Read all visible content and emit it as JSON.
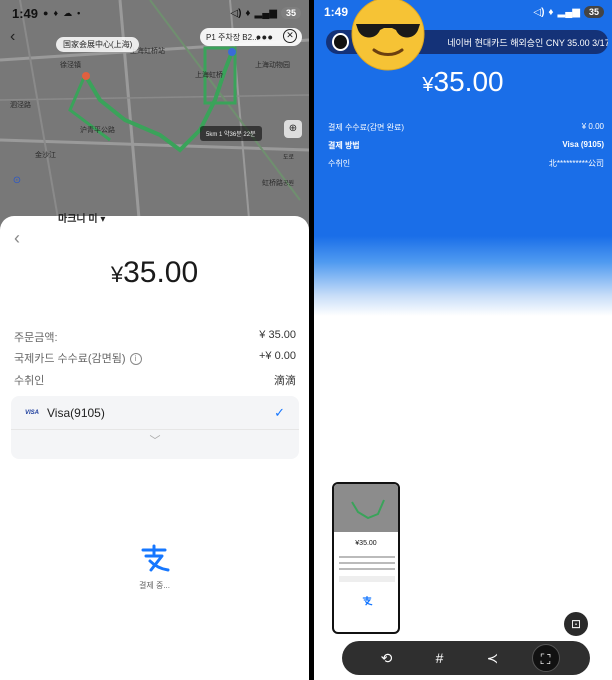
{
  "left": {
    "status": {
      "time": "1:49",
      "battery": "35"
    },
    "map": {
      "badge": "国家会展中心(上海)",
      "pill": "P1 주차장 B2...",
      "labels": [
        "徐泾镇",
        "上海虹桥站",
        "上海虹桥",
        "上海动物园",
        "沪青平公路",
        "泗泾路",
        "金沙江",
        "虹桥路"
      ],
      "tooltip": "5km 1 약36분 22분",
      "side_labels": [
        "도로",
        "공원"
      ],
      "under_text": "마크니 미 ▾"
    },
    "amount": {
      "currency": "¥",
      "value": "35.00"
    },
    "details": [
      {
        "label": "주문금액:",
        "value": "¥ 35.00"
      },
      {
        "label": "국제카드 수수료(감면됨)",
        "value": "+¥ 0.00"
      },
      {
        "label": "수취인",
        "value": "滴滴"
      }
    ],
    "card": {
      "brand": "VISA",
      "label": "Visa(9105)"
    },
    "paying_text": "결제 중..."
  },
  "right": {
    "status": {
      "time": "1:49",
      "battery": "35"
    },
    "notification": "네이버 현대카드 해외승인 CNY 35.00 3/17...",
    "amount": {
      "currency": "¥",
      "value": "35.00"
    },
    "rows": [
      {
        "label": "결제 수수료(감면 완료)",
        "value": "¥ 0.00",
        "bold": false
      },
      {
        "label": "결제 방법",
        "value": "Visa (9105)",
        "bold": true
      },
      {
        "label": "수취인",
        "value": "北**********公司",
        "bold": false
      }
    ],
    "thumb_amount": "¥35.00",
    "toolbar_icons": [
      "crop-draw-icon",
      "hashtag-icon",
      "share-icon",
      "scan-capture-icon"
    ]
  },
  "colors": {
    "alipay_blue": "#1677ff",
    "header_blue": "#1a6ee8",
    "route_green": "#3aa35a"
  }
}
